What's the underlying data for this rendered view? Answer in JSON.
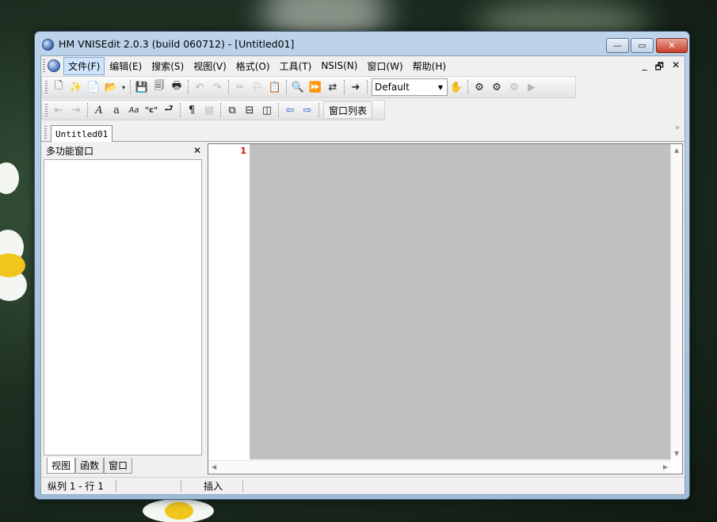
{
  "window": {
    "title": "HM VNISEdit 2.0.3 (build 060712) - [Untitled01]"
  },
  "caption_buttons": {
    "minimize": "—",
    "maximize": "▭",
    "close": "✕"
  },
  "menu": {
    "items": [
      "文件(F)",
      "编辑(E)",
      "搜索(S)",
      "视图(V)",
      "格式(O)",
      "工具(T)",
      "NSIS(N)",
      "窗口(W)",
      "帮助(H)"
    ],
    "mdi_controls": [
      "_",
      "🗗",
      "✕"
    ]
  },
  "toolbar": {
    "combo_value": "Default",
    "window_list_label": "窗口列表"
  },
  "document_tab": {
    "label": "Untitled01"
  },
  "side_panel": {
    "title": "多功能窗口",
    "close": "✕",
    "tabs": [
      "视图",
      "函数",
      "窗口"
    ]
  },
  "editor": {
    "line_number": "1"
  },
  "status": {
    "position": "纵列 1 - 行 1",
    "mode": "插入"
  },
  "colors": {
    "line_number": "#e00000",
    "editor_background": "#c0c0c0",
    "menu_highlight": "#cfe3fb"
  }
}
